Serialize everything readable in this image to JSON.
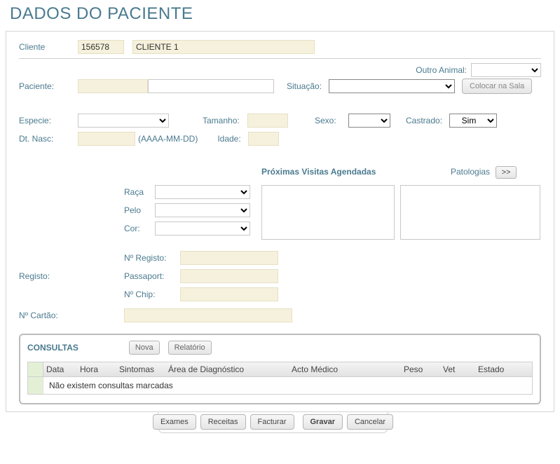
{
  "title": "DADOS DO PACIENTE",
  "labels": {
    "cliente": "Cliente",
    "outroAnimal": "Outro Animal:",
    "paciente": "Paciente:",
    "situacao": "Situação:",
    "colocarSala": "Colocar na Sala",
    "especie": "Especie:",
    "tamanho": "Tamanho:",
    "sexo": "Sexo:",
    "castrado": "Castrado:",
    "dtNasc": "Dt. Nasc:",
    "dtNascFmt": "(AAAA-MM-DD)",
    "idade": "Idade:",
    "proxVisitas": "Próximas Visitas Agendadas",
    "patologias": "Patologias",
    "raca": "Raça",
    "pelo": "Pelo",
    "cor": "Cor:",
    "nRegisto": "Nº Registo:",
    "registo": "Registo:",
    "passaport": "Passaport:",
    "nChip": "Nº Chip:",
    "nCartao": "Nº Cartão:",
    "arrows": ">>"
  },
  "values": {
    "clienteId": "156578",
    "clienteNome": "CLIENTE 1",
    "castrado": "Sim"
  },
  "consultas": {
    "title": "CONSULTAS",
    "btnNova": "Nova",
    "btnRelatorio": "Relatório",
    "columns": {
      "data": "Data",
      "hora": "Hora",
      "sintomas": "Sintomas",
      "areaDiag": "Área de Diagnóstico",
      "actoMedico": "Acto Médico",
      "peso": "Peso",
      "vet": "Vet",
      "estado": "Estado"
    },
    "empty": "Não existem consultas marcadas"
  },
  "footer": {
    "exames": "Exames",
    "receitas": "Receitas",
    "facturar": "Facturar",
    "gravar": "Gravar",
    "cancelar": "Cancelar"
  }
}
